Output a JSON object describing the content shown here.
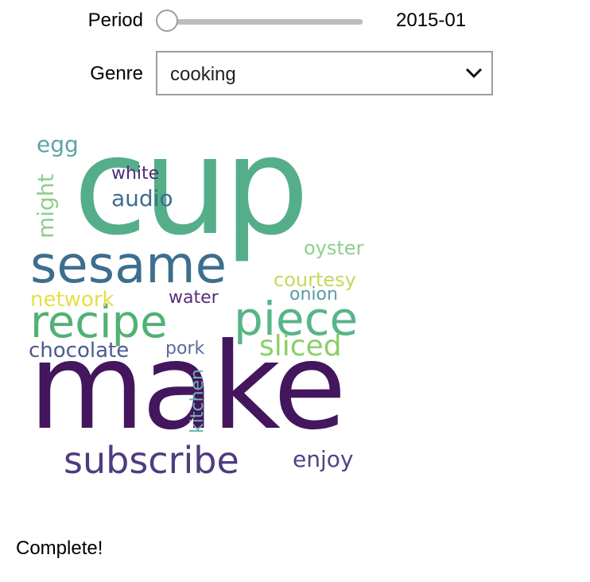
{
  "period": {
    "label": "Period",
    "value": "2015-01",
    "position": 0.0
  },
  "genre": {
    "label": "Genre",
    "selected": "cooking"
  },
  "word_cloud": {
    "words": [
      {
        "text": "cup",
        "color": "#55ae8a"
      },
      {
        "text": "make",
        "color": "#43165e"
      },
      {
        "text": "sesame",
        "color": "#3e6e8e"
      },
      {
        "text": "recipe",
        "color": "#52b174"
      },
      {
        "text": "piece",
        "color": "#58b586"
      },
      {
        "text": "subscribe",
        "color": "#4e3c80"
      },
      {
        "text": "sliced",
        "color": "#8acf6a"
      },
      {
        "text": "audio",
        "color": "#3e6d8f"
      },
      {
        "text": "chocolate",
        "color": "#4c5a8f"
      },
      {
        "text": "courtesy",
        "color": "#c3d95a"
      },
      {
        "text": "network",
        "color": "#e6df46"
      },
      {
        "text": "enjoy",
        "color": "#4a4787"
      },
      {
        "text": "oyster",
        "color": "#8dcf91"
      },
      {
        "text": "onion",
        "color": "#5b9aa2"
      },
      {
        "text": "white",
        "color": "#4b2f7b"
      },
      {
        "text": "egg",
        "color": "#5ea3a7"
      },
      {
        "text": "water",
        "color": "#5a2d78"
      },
      {
        "text": "pork",
        "color": "#5a6c9a"
      },
      {
        "text": "might",
        "color": "#8ccf8e"
      },
      {
        "text": "kitchen",
        "color": "#6fb2b0"
      }
    ]
  },
  "status": "Complete!"
}
